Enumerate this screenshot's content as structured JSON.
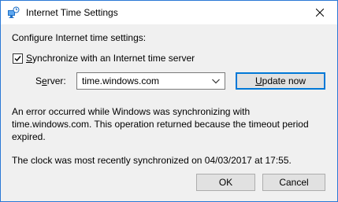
{
  "window": {
    "title": "Internet Time Settings",
    "close_label": "✕"
  },
  "content": {
    "heading": "Configure Internet time settings:",
    "sync_checkbox": {
      "checked": true,
      "label": "Synchronize with an Internet time server",
      "accel": "S",
      "rest": "ynchronize with an Internet time server"
    },
    "server": {
      "label": "Server:",
      "value": "time.windows.com"
    },
    "update_button": "Update now",
    "error_lines": [
      "An error occurred while Windows was synchronizing with",
      "time.windows.com.  This operation returned because the timeout period",
      "expired."
    ],
    "last_sync": "The clock was most recently synchronized on 04/03/2017 at 17:55."
  },
  "buttons": {
    "ok": "OK",
    "cancel": "Cancel"
  },
  "colors": {
    "accent": "#0078d7",
    "window_border": "#2b79d6",
    "dialog_bg": "#f0f0f0",
    "button_bg": "#e1e1e1"
  },
  "icons": {
    "title": "internet-time-settings-icon",
    "close": "close-icon",
    "checkbox": "checkmark-icon",
    "dropdown": "chevron-down-icon"
  }
}
